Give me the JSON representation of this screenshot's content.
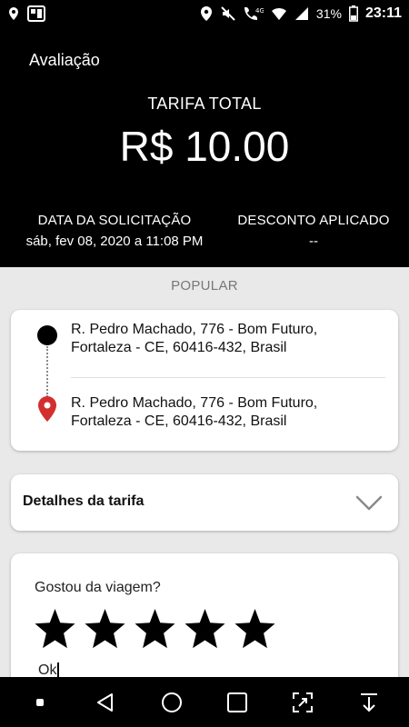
{
  "status_bar": {
    "network_label": "4G",
    "battery": "31%",
    "time": "23:11"
  },
  "header": {
    "title": "Avaliação",
    "total_label": "TARIFA TOTAL",
    "total_value": "R$ 10.00",
    "request_date_label": "DATA DA SOLICITAÇÃO",
    "request_date_value": "sáb, fev 08, 2020 a 11:08 PM",
    "discount_label": "DESCONTO APLICADO",
    "discount_value": "--"
  },
  "category": "POPULAR",
  "route": {
    "origin": {
      "line1": "R. Pedro Machado, 776 - Bom Futuro,",
      "line2": "Fortaleza - CE, 60416-432, Brasil"
    },
    "destination": {
      "line1": "R. Pedro Machado, 776 - Bom Futuro,",
      "line2": "Fortaleza - CE, 60416-432, Brasil"
    }
  },
  "fare_details": {
    "label": "Detalhes da tarifa",
    "icon": "chevron-down-icon"
  },
  "rating": {
    "question": "Gostou da viagem?",
    "stars_filled": 5,
    "stars_total": 5,
    "comment": "Ok"
  },
  "colors": {
    "header_bg": "#000000",
    "page_bg": "#e9e9e9",
    "pin_red": "#d32f2f"
  },
  "nav_bar": {
    "icons": [
      "dot-icon",
      "back-icon",
      "home-icon",
      "recents-icon",
      "screenshot-icon",
      "download-icon"
    ]
  }
}
